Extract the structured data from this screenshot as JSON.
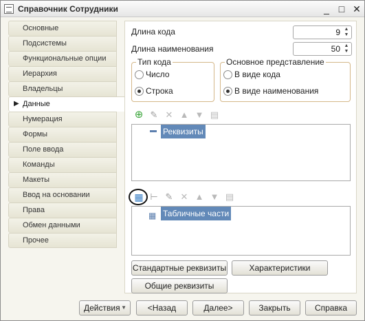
{
  "window": {
    "title": "Справочник Сотрудники",
    "minimize_glyph": "_",
    "maximize_glyph": "□",
    "close_glyph": "✕"
  },
  "sidebar": {
    "items": [
      {
        "label": "Основные"
      },
      {
        "label": "Подсистемы"
      },
      {
        "label": "Функциональные опции"
      },
      {
        "label": "Иерархия"
      },
      {
        "label": "Владельцы"
      },
      {
        "label": "Данные",
        "active": true
      },
      {
        "label": "Нумерация"
      },
      {
        "label": "Формы"
      },
      {
        "label": "Поле ввода"
      },
      {
        "label": "Команды"
      },
      {
        "label": "Макеты"
      },
      {
        "label": "Ввод на основании"
      },
      {
        "label": "Права"
      },
      {
        "label": "Обмен данными"
      },
      {
        "label": "Прочее"
      }
    ]
  },
  "data_page": {
    "code_length_label": "Длина кода",
    "code_length_value": "9",
    "name_length_label": "Длина наименования",
    "name_length_value": "50",
    "code_type": {
      "legend": "Тип кода",
      "options": [
        "Число",
        "Строка"
      ],
      "selected": "Строка"
    },
    "main_presentation": {
      "legend": "Основное представление",
      "options": [
        "В виде кода",
        "В виде наименования"
      ],
      "selected": "В виде наименования"
    },
    "attributes_tree": {
      "root_label": "Реквизиты"
    },
    "tabular_tree": {
      "root_label": "Табличные части"
    },
    "buttons": {
      "standard_attributes": "Стандартные реквизиты",
      "characteristics": "Характеристики",
      "common_attributes": "Общие реквизиты"
    }
  },
  "footer": {
    "actions": "Действия",
    "back": "<Назад",
    "next": "Далее>",
    "close": "Закрыть",
    "help": "Справка"
  },
  "colors": {
    "selection": "#6289b8",
    "group_border": "#d4b788",
    "add_icon": "#3aa53a",
    "delete_icon": "#c44"
  }
}
